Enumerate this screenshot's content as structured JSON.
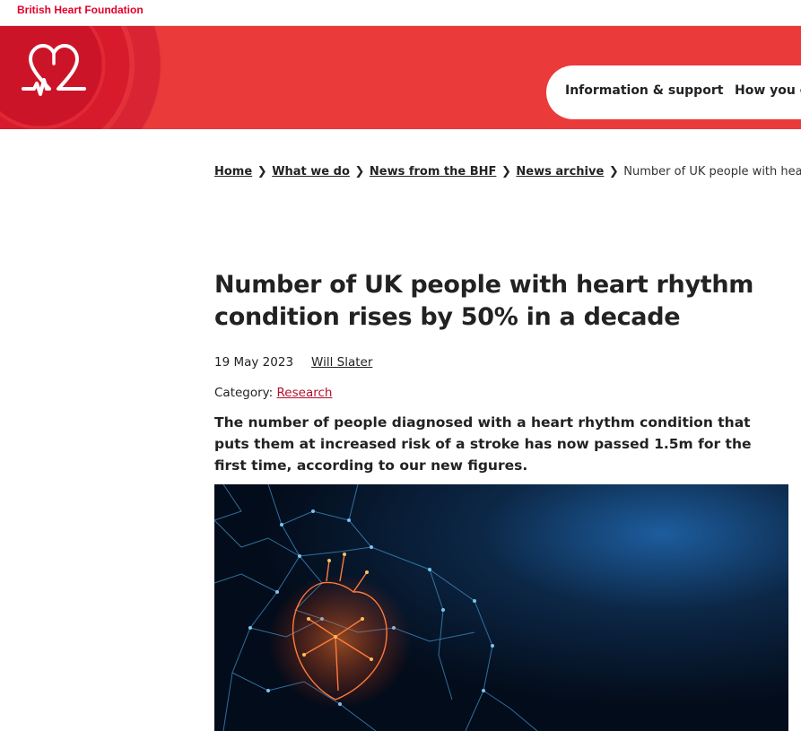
{
  "topbar": {
    "brand": "British Heart Foundation"
  },
  "nav": {
    "items": [
      "Information & support",
      "How you c"
    ]
  },
  "breadcrumb": {
    "links": [
      "Home",
      "What we do",
      "News from the BHF",
      "News archive"
    ],
    "current": "Number of UK people with heart r"
  },
  "article": {
    "title": "Number of UK people with heart rhythm condition rises by 50% in a decade",
    "date": "19 May 2023",
    "author": "Will Slater",
    "category_label": "Category:",
    "category": "Research",
    "lede": "The number of people diagnosed with a heart rhythm condition that puts them at increased risk of a stroke has now passed 1.5m for the first time, according to our new figures."
  },
  "colors": {
    "brand_red": "#ea3a3a",
    "brand_text_red": "#e4002b",
    "link_red": "#b0122e"
  },
  "icons": {
    "logo": "heart-logo-icon",
    "separator": "chevron-right-icon"
  }
}
